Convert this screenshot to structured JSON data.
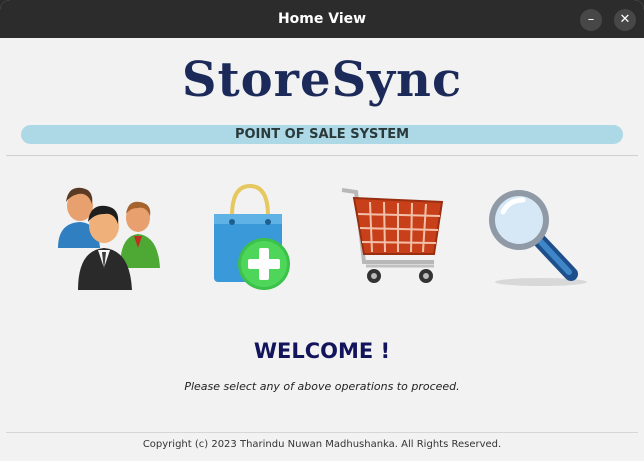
{
  "window": {
    "title": "Home View",
    "minimize_label": "–",
    "close_label": "✕"
  },
  "header": {
    "logo_text": "StoreSync",
    "banner_text": "POINT OF SALE SYSTEM"
  },
  "operations": [
    {
      "icon": "customers-icon"
    },
    {
      "icon": "add-product-bag-icon"
    },
    {
      "icon": "shopping-cart-icon"
    },
    {
      "icon": "magnifying-glass-icon"
    }
  ],
  "main": {
    "welcome": "WELCOME !",
    "instruction": "Please select any of above operations to proceed."
  },
  "footer": {
    "copyright": "Copyright (c) 2023 Tharindu Nuwan Madhushanka. All Rights Reserved."
  },
  "colors": {
    "titlebar": "#2c2c2c",
    "logo": "#1c2a5a",
    "banner": "#add8e6",
    "welcome": "#13155c"
  }
}
